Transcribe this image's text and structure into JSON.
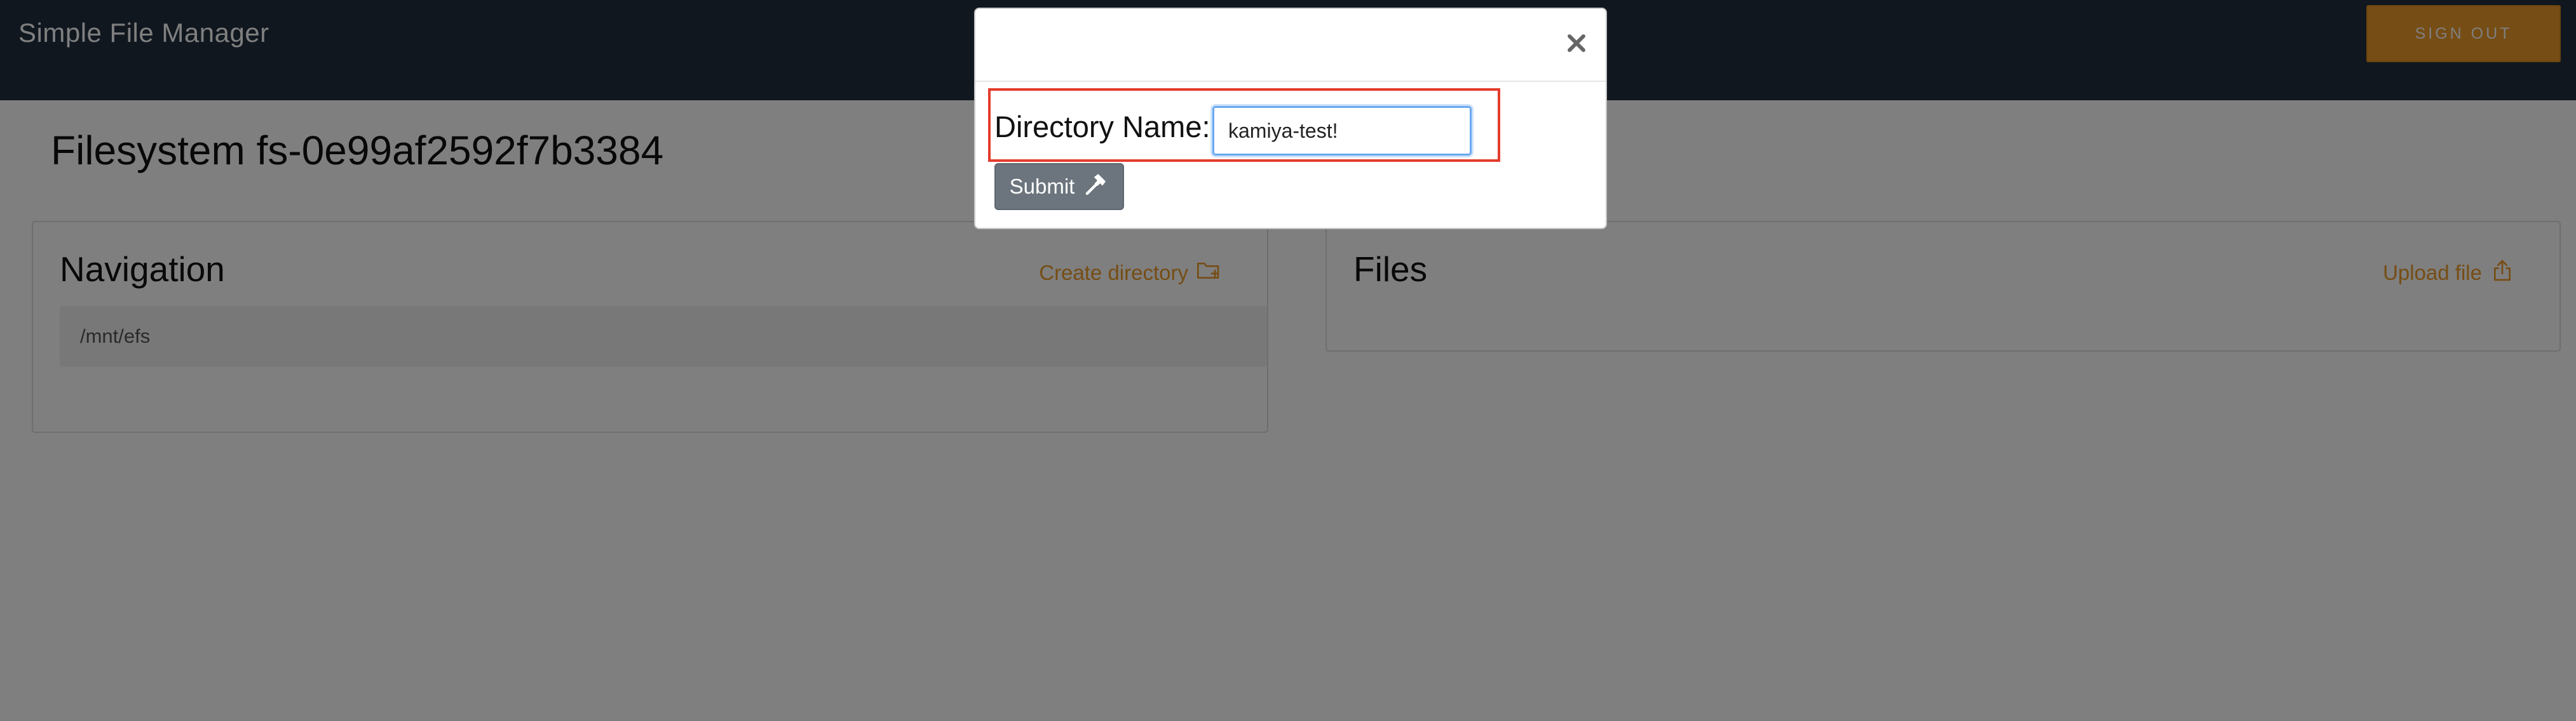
{
  "header": {
    "app_title": "Simple File Manager",
    "sign_out_label": "SIGN OUT"
  },
  "page": {
    "title": "Filesystem fs-0e99af2592f7b3384"
  },
  "navigation": {
    "title": "Navigation",
    "action_label": "Create directory",
    "action_icon": "folder-plus-icon",
    "current_path": "/mnt/efs"
  },
  "files": {
    "title": "Files",
    "action_label": "Upload file",
    "action_icon": "upload-icon"
  },
  "modal": {
    "close_icon": "close-icon",
    "label": "Directory Name:",
    "input_value": "kamiya-test!",
    "submit_label": "Submit",
    "submit_icon": "hammer-icon"
  },
  "colors": {
    "header_bg": "#232f3e",
    "accent": "#ec9a29",
    "highlight": "#e53b2c",
    "submit_bg": "#6c757d"
  }
}
